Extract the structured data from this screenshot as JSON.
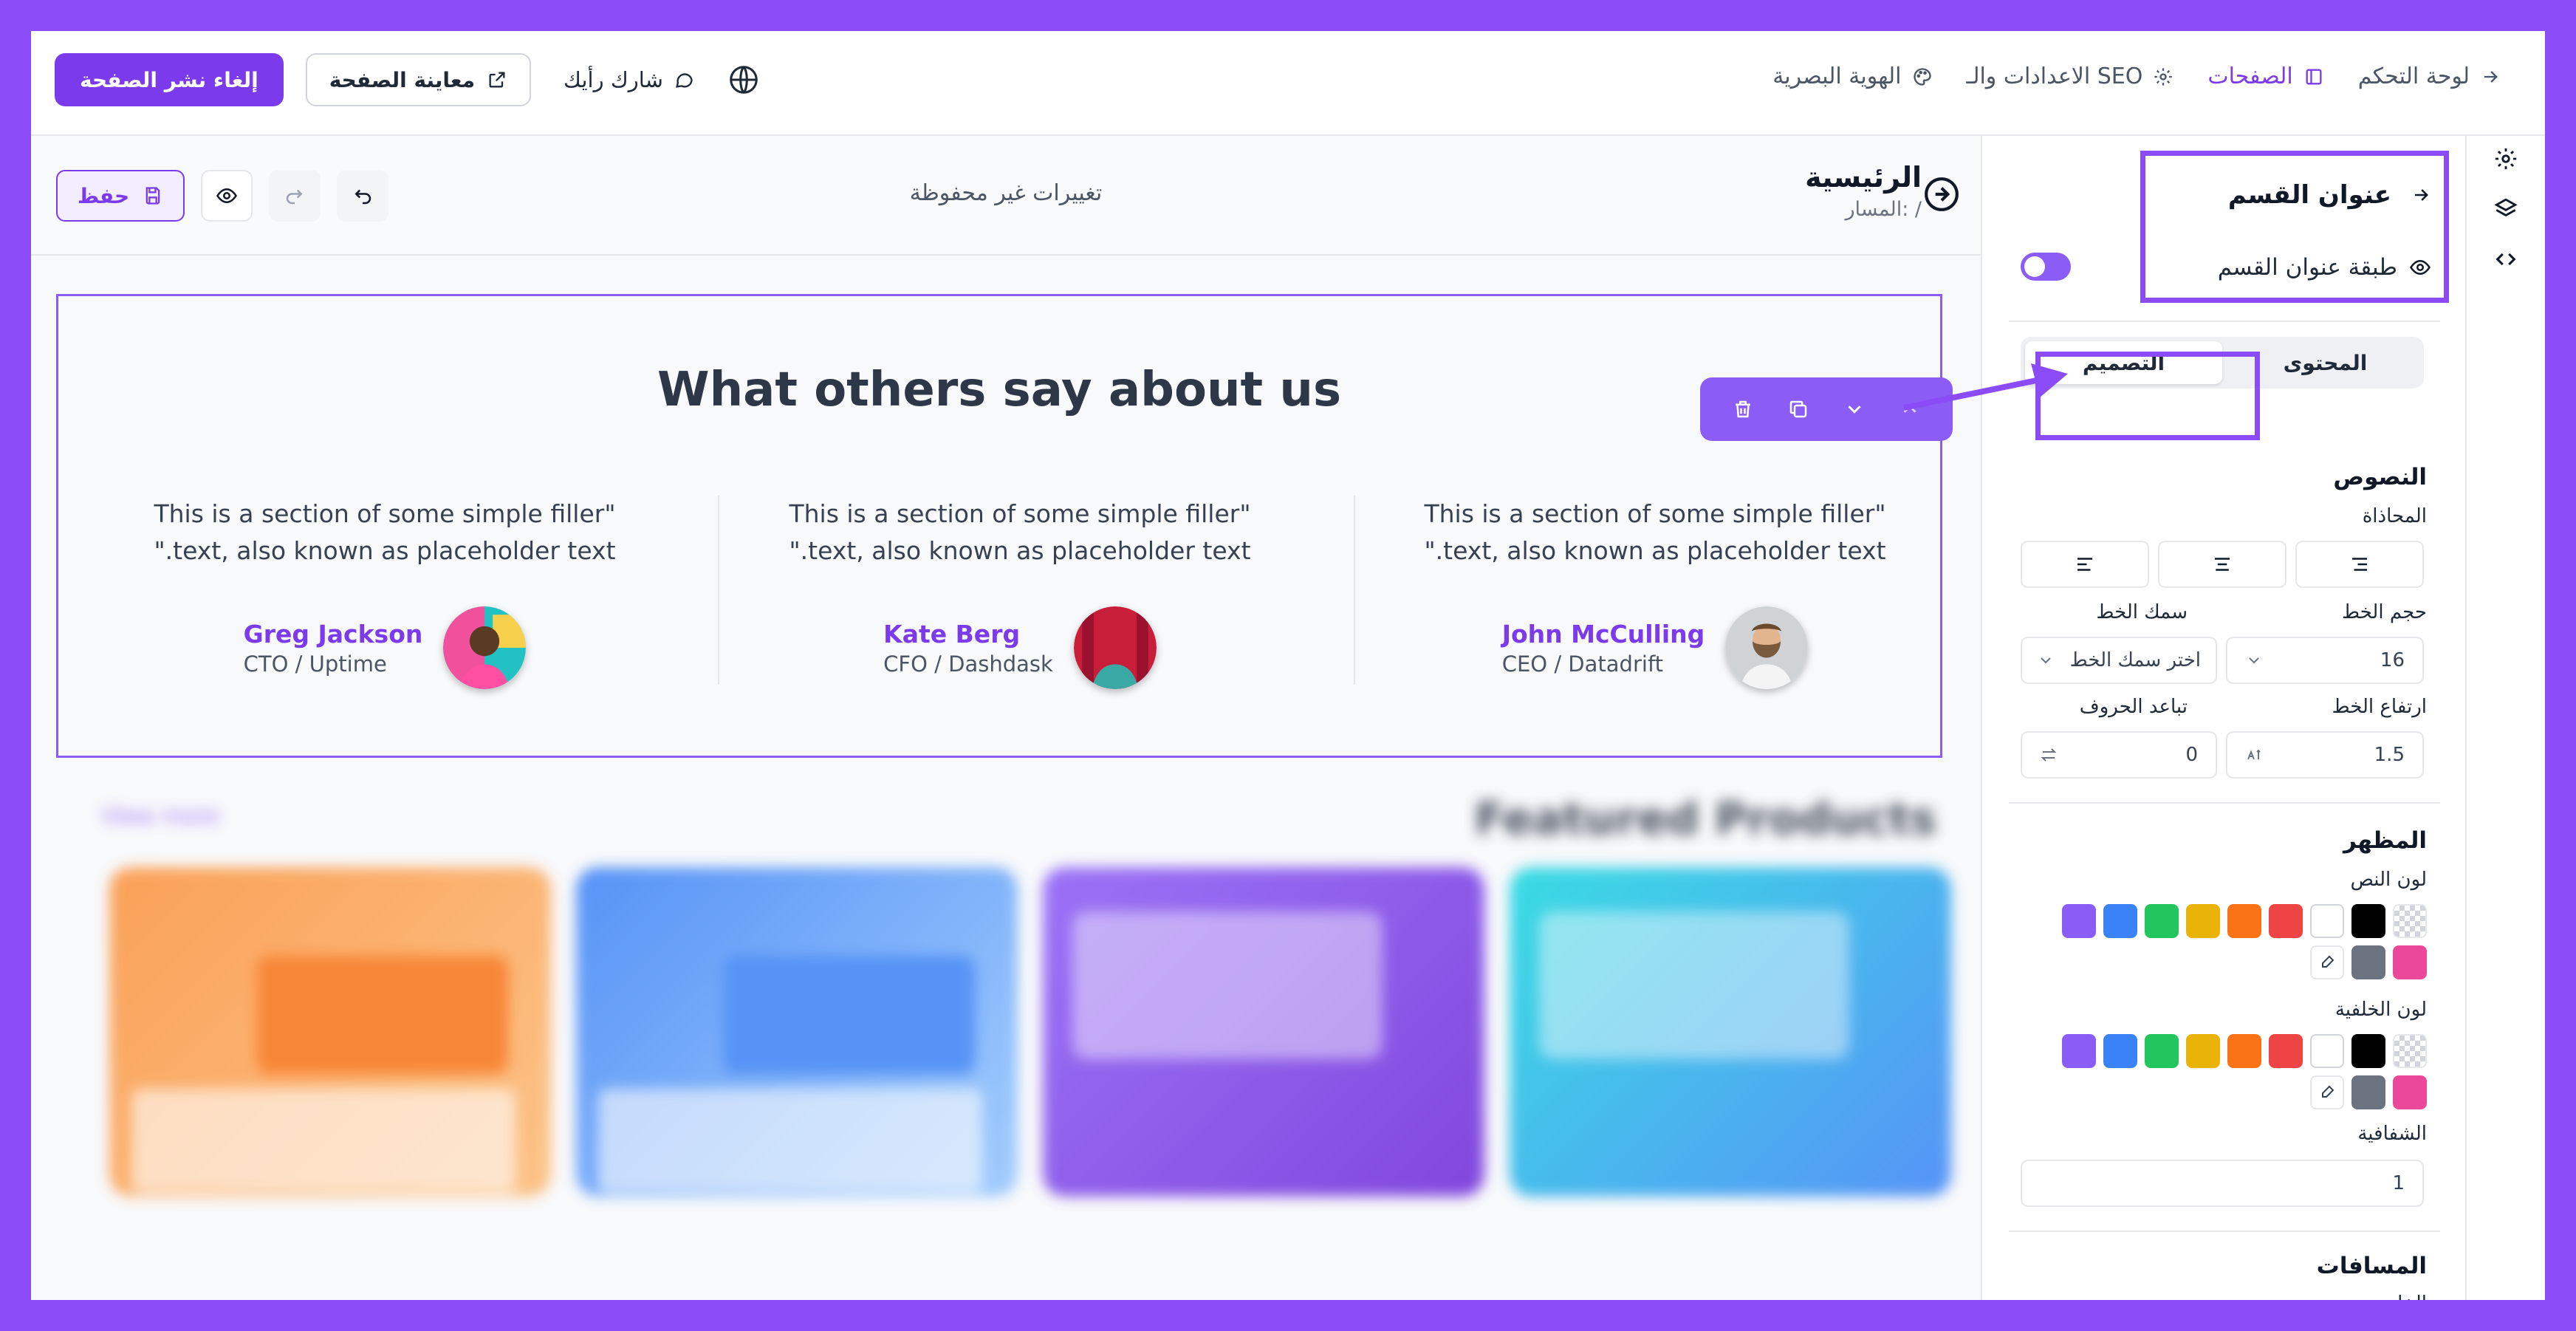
{
  "nav": {
    "dashboard": "لوحة التحكم",
    "pages": "الصفحات",
    "settings_seo": "الاعدادات والـ SEO",
    "visual_identity": "الهوية البصرية"
  },
  "actions": {
    "unpublish": "إلغاء نشر الصفحة",
    "preview": "معاينة الصفحة",
    "feedback": "شارك رأيك"
  },
  "page": {
    "title": "الرئيسية",
    "path": "المسار: /",
    "unsaved": "تغييرات غير محفوظة",
    "save": "حفظ"
  },
  "section": {
    "title": "What others say about us",
    "testimonials": [
      {
        "quote_line1": "This is a section of some simple filler\"",
        "quote_line2": "\".text, also known as placeholder text",
        "name": "John McCulling",
        "role": "CEO / Datadrift"
      },
      {
        "quote_line1": "This is a section of some simple filler\"",
        "quote_line2": "\".text, also known as placeholder text",
        "name": "Kate Berg",
        "role": "CFO / Dashdask"
      },
      {
        "quote_line1": "This is a section of some simple filler\"",
        "quote_line2": "\".text, also known as placeholder text",
        "name": "Greg Jackson",
        "role": "CTO / Uptime"
      }
    ]
  },
  "featured": {
    "title": "Featured Products",
    "link": "View more"
  },
  "panel": {
    "title": "عنوان القسم",
    "layer": "طبقة عنوان القسم",
    "tab_content": "المحتوى",
    "tab_design": "التصميم",
    "texts_heading": "النصوص",
    "alignment": "المحاذاة",
    "font_size": "حجم الخط",
    "font_weight": "سمك الخط",
    "font_size_value": "16",
    "font_weight_placeholder": "اختر سمك الخط",
    "line_height": "ارتفاع الخط",
    "letter_spacing": "تباعد الحروف",
    "line_height_value": "1.5",
    "letter_spacing_value": "0",
    "appearance_heading": "المظهر",
    "text_color": "لون النص",
    "bg_color": "لون الخلفية",
    "opacity": "الشفافية",
    "opacity_value": "1",
    "spacing_heading": "المسافات",
    "outer": "الخارج"
  },
  "swatch_colors": [
    "transparent",
    "#000000",
    "#ffffff",
    "#ef4444",
    "#f97316",
    "#eab308",
    "#22c55e",
    "#3b82f6",
    "#8b5cf6",
    "#ec4899",
    "#6b7280",
    "picker"
  ],
  "accent": "#7c3aed"
}
